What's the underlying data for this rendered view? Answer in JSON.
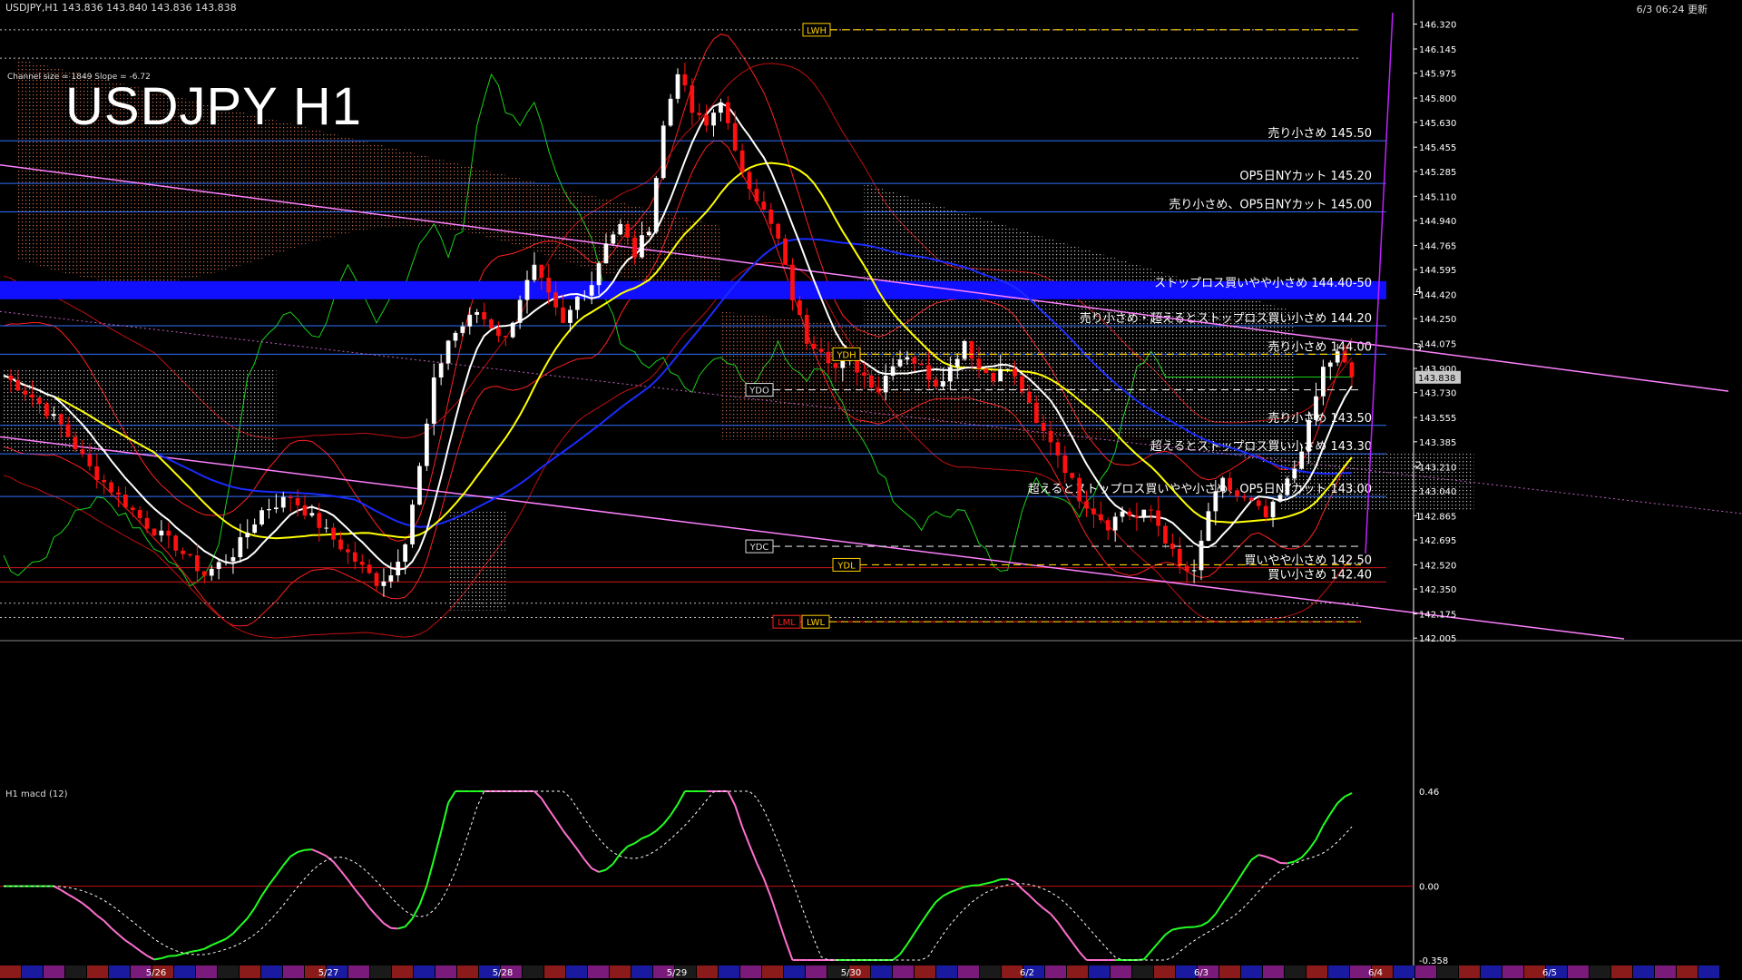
{
  "header": {
    "symbol_info": "USDJPY,H1  143.836 143.840 143.836 143.838",
    "datetime": "6/3 06:24 更新",
    "channel_info": "Channel size = 1849 Slope = -6.72",
    "big_title": "USDJPY H1",
    "macd_label": "H1  macd (12)"
  },
  "colors": {
    "background": "#000000",
    "bull_candle": "#ffffff",
    "bear_candle": "#ff1010",
    "ma_white": "#ffffff",
    "ma_yellow": "#ffff00",
    "ma_blue": "#1a2bff",
    "band_red": "#ff2020",
    "chikou_green": "#19d019",
    "channel_pink": "#ff80ff",
    "level_line": "#2f6fff",
    "highlight_band": "#1010ff",
    "macd_up": "#22ff22",
    "macd_down": "#ff6fcf",
    "price_tag_bg": "#c8c8c8"
  },
  "chart_data": {
    "type": "candlestick",
    "symbol": "USDJPY",
    "timeframe": "H1",
    "ylim": [
      142.0,
      146.4
    ],
    "y_ticks": [
      "146.320",
      "146.145",
      "145.975",
      "145.800",
      "145.630",
      "145.455",
      "145.285",
      "145.110",
      "144.940",
      "144.765",
      "144.595",
      "144.420",
      "144.250",
      "144.075",
      "143.900",
      "143.730",
      "143.555",
      "143.385",
      "143.210",
      "143.040",
      "142.865",
      "142.695",
      "142.520",
      "142.350",
      "142.175",
      "142.005"
    ],
    "current_price": "143.838",
    "date_labels": [
      "5/26",
      "5/27",
      "5/28",
      "5/29",
      "5/30",
      "6/2",
      "6/3",
      "6/4",
      "6/5"
    ],
    "close_path": [
      [
        0,
        143.85
      ],
      [
        4,
        143.7
      ],
      [
        8,
        143.5
      ],
      [
        12,
        143.2
      ],
      [
        16,
        143.0
      ],
      [
        20,
        142.8
      ],
      [
        24,
        142.65
      ],
      [
        28,
        142.45
      ],
      [
        32,
        142.6
      ],
      [
        36,
        142.9
      ],
      [
        40,
        143.0
      ],
      [
        44,
        142.8
      ],
      [
        48,
        142.6
      ],
      [
        52,
        142.4
      ],
      [
        54,
        142.45
      ],
      [
        56,
        142.7
      ],
      [
        58,
        143.2
      ],
      [
        60,
        143.8
      ],
      [
        62,
        144.1
      ],
      [
        64,
        144.2
      ],
      [
        66,
        144.3
      ],
      [
        68,
        144.2
      ],
      [
        70,
        144.1
      ],
      [
        72,
        144.4
      ],
      [
        74,
        144.6
      ],
      [
        76,
        144.4
      ],
      [
        78,
        144.2
      ],
      [
        80,
        144.4
      ],
      [
        82,
        144.5
      ],
      [
        84,
        144.8
      ],
      [
        86,
        144.9
      ],
      [
        88,
        144.7
      ],
      [
        90,
        144.9
      ],
      [
        92,
        145.6
      ],
      [
        94,
        146.0
      ],
      [
        96,
        145.7
      ],
      [
        98,
        145.6
      ],
      [
        100,
        145.8
      ],
      [
        102,
        145.4
      ],
      [
        104,
        145.2
      ],
      [
        106,
        145.0
      ],
      [
        108,
        144.8
      ],
      [
        110,
        144.4
      ],
      [
        112,
        144.1
      ],
      [
        114,
        144.05
      ],
      [
        116,
        143.9
      ],
      [
        118,
        143.95
      ],
      [
        120,
        143.85
      ],
      [
        122,
        143.75
      ],
      [
        124,
        143.95
      ],
      [
        126,
        144.0
      ],
      [
        128,
        143.9
      ],
      [
        130,
        143.8
      ],
      [
        132,
        143.9
      ],
      [
        134,
        144.1
      ],
      [
        136,
        143.9
      ],
      [
        138,
        143.85
      ],
      [
        140,
        143.9
      ],
      [
        142,
        143.75
      ],
      [
        144,
        143.5
      ],
      [
        146,
        143.4
      ],
      [
        148,
        143.2
      ],
      [
        150,
        143.0
      ],
      [
        152,
        142.9
      ],
      [
        154,
        142.8
      ],
      [
        156,
        142.9
      ],
      [
        158,
        142.85
      ],
      [
        160,
        142.9
      ],
      [
        162,
        142.7
      ],
      [
        164,
        142.5
      ],
      [
        166,
        142.45
      ],
      [
        168,
        142.9
      ],
      [
        170,
        143.1
      ],
      [
        172,
        143.0
      ],
      [
        174,
        142.95
      ],
      [
        176,
        142.85
      ],
      [
        178,
        143.0
      ],
      [
        180,
        143.2
      ],
      [
        182,
        143.5
      ],
      [
        184,
        143.9
      ],
      [
        186,
        144.0
      ],
      [
        188,
        143.84
      ]
    ],
    "horizontal_levels": [
      {
        "price": 145.5,
        "label": "売り小さめ 145.50"
      },
      {
        "price": 145.2,
        "label": "OP5日NYカット 145.20"
      },
      {
        "price": 145.0,
        "label": "売り小さめ、OP5日NYカット 145.00"
      },
      {
        "price": 144.45,
        "label": "ストップロス買いやや小さめ 144.40-50"
      },
      {
        "price": 144.2,
        "label": "売り小さめ・超えるとストップロス買い小さめ 144.20"
      },
      {
        "price": 144.0,
        "label": "売り小さめ 144.00"
      },
      {
        "price": 143.5,
        "label": "売り小さめ 143.50"
      },
      {
        "price": 143.3,
        "label": "超えるとストップロス買い小さめ 143.30"
      },
      {
        "price": 143.0,
        "label": "超えるとストップロス買いやや小さめ、OP5日NYカット 143.00"
      },
      {
        "price": 142.5,
        "label": "買いやや小さめ 142.50"
      },
      {
        "price": 142.4,
        "label": "買い小さめ 142.40"
      }
    ],
    "tags": [
      {
        "text": "LWH",
        "price": 146.28
      },
      {
        "text": "YDH",
        "price": 144.0
      },
      {
        "text": "YDO",
        "price": 143.75
      },
      {
        "text": "YDC",
        "price": 142.65
      },
      {
        "text": "YDL",
        "price": 142.52
      },
      {
        "text": "LML",
        "price": 142.12
      },
      {
        "text": "LWL",
        "price": 142.12
      }
    ],
    "channel_numbers": [
      "4",
      "3",
      "2",
      "1"
    ],
    "macd": {
      "ylim": [
        -0.358,
        0.46
      ],
      "ticks": [
        "0.46",
        "0.00",
        "-0.358"
      ]
    }
  }
}
